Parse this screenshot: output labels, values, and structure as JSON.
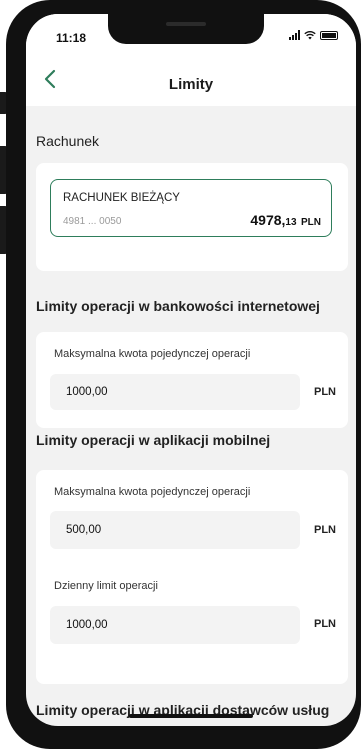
{
  "status": {
    "time": "11:18"
  },
  "header": {
    "title": "Limity"
  },
  "account_section": {
    "heading": "Rachunek",
    "account": {
      "name": "RACHUNEK BIEŻĄCY",
      "number": "4981 ... 0050",
      "balance_main": "4978,",
      "balance_fraction": "13",
      "currency": "PLN"
    }
  },
  "internet_section": {
    "heading": "Limity operacji w bankowości internetowej",
    "fields": [
      {
        "label": "Maksymalna kwota pojedynczej operacji",
        "value": "1000,00",
        "currency": "PLN"
      }
    ]
  },
  "mobile_section": {
    "heading": "Limity operacji w aplikacji mobilnej",
    "fields": [
      {
        "label": "Maksymalna kwota pojedynczej operacji",
        "value": "500,00",
        "currency": "PLN"
      },
      {
        "label": "Dzienny limit operacji",
        "value": "1000,00",
        "currency": "PLN"
      }
    ]
  },
  "providers_section": {
    "heading": "Limity operacji w aplikacji dostawców usług"
  },
  "colors": {
    "accent": "#2e7d5b",
    "background": "#f2f2f2"
  }
}
